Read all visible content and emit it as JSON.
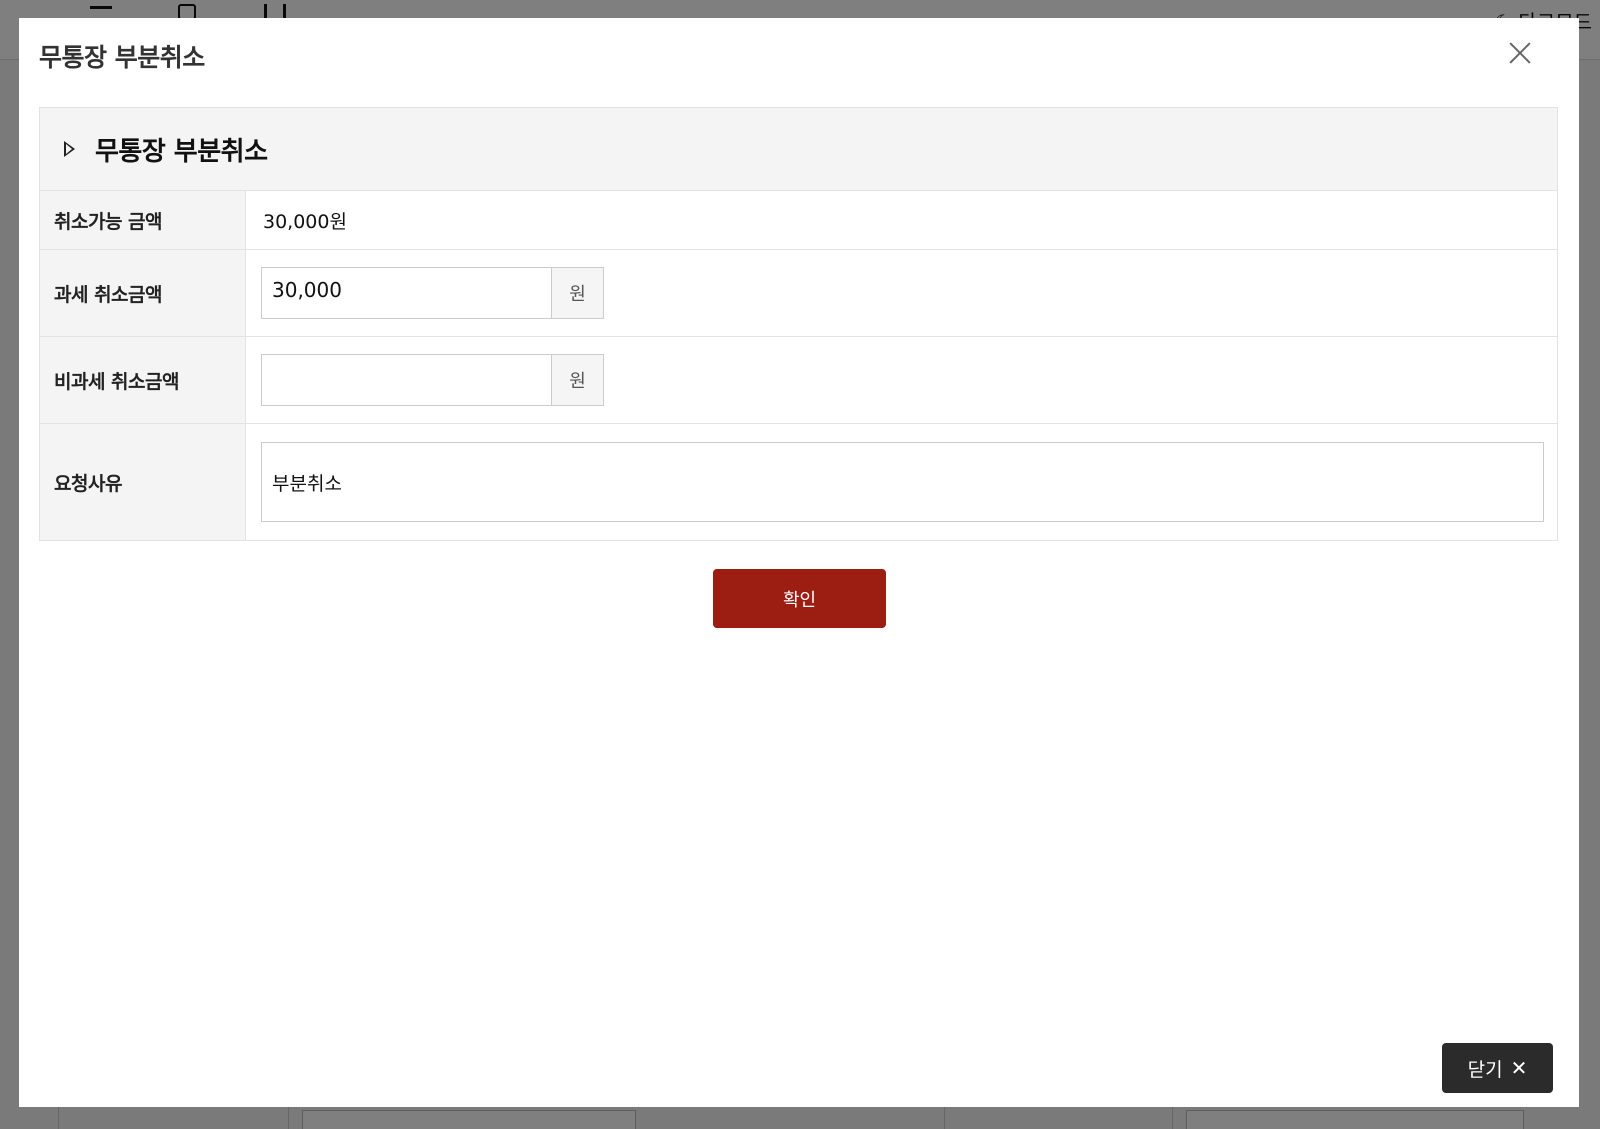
{
  "background": {
    "darkmode_label": "다크모드"
  },
  "modal": {
    "title": "무통장 부분취소",
    "close_icon": "close-icon"
  },
  "panel": {
    "title": "무통장 부분취소",
    "rows": [
      {
        "label": "취소가능 금액",
        "value": "30,000원"
      },
      {
        "label": "과세 취소금액",
        "input_value": "30,000",
        "unit": "원"
      },
      {
        "label": "비과세 취소금액",
        "input_value": "",
        "unit": "원"
      },
      {
        "label": "요청사유",
        "input_value": "부분취소"
      }
    ]
  },
  "buttons": {
    "confirm_label": "확인",
    "close_label": "닫기",
    "close_icon_glyph": "✕"
  },
  "colors": {
    "confirm_bg": "#9c1d12",
    "close_bg": "#2b2b2b",
    "overlay": "rgba(0,0,0,0.5)"
  }
}
